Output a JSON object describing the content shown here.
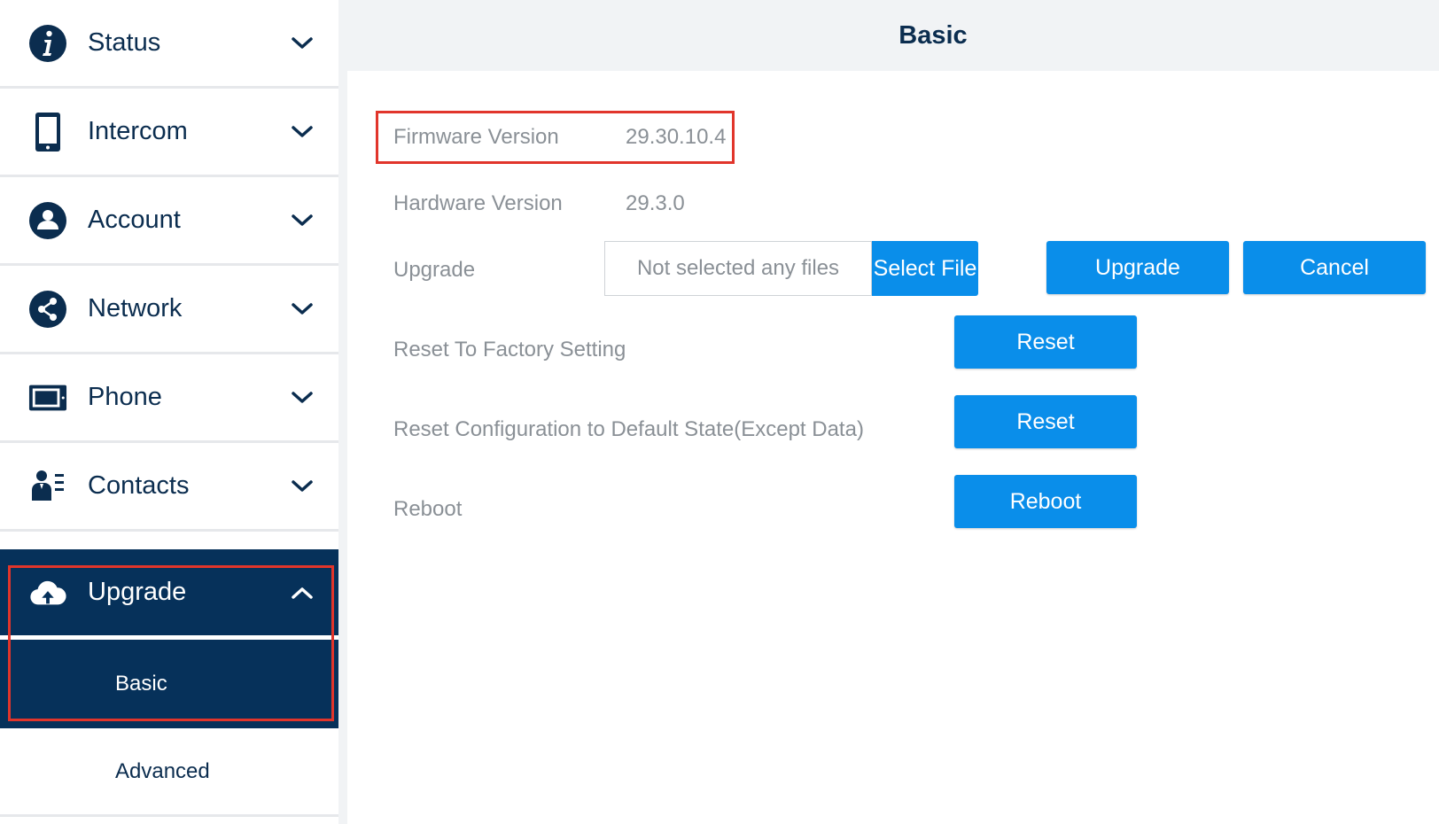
{
  "sidebar": {
    "items": [
      {
        "label": "Status",
        "icon": "info-icon"
      },
      {
        "label": "Intercom",
        "icon": "tablet-icon"
      },
      {
        "label": "Account",
        "icon": "user-icon"
      },
      {
        "label": "Network",
        "icon": "network-icon"
      },
      {
        "label": "Phone",
        "icon": "phone-screen-icon"
      },
      {
        "label": "Contacts",
        "icon": "contacts-icon"
      },
      {
        "label": "Upgrade",
        "icon": "cloud-upload-icon"
      }
    ],
    "subitems": [
      {
        "label": "Basic"
      },
      {
        "label": "Advanced"
      }
    ]
  },
  "main": {
    "title": "Basic",
    "firmware": {
      "label": "Firmware Version",
      "value": "29.30.10.4"
    },
    "hardware": {
      "label": "Hardware Version",
      "value": "29.3.0"
    },
    "upgrade": {
      "label": "Upgrade",
      "file_status": "Not selected any files",
      "select_file_label": "Select File",
      "upgrade_label": "Upgrade",
      "cancel_label": "Cancel"
    },
    "reset_factory": {
      "label": "Reset To Factory Setting",
      "button": "Reset"
    },
    "reset_config": {
      "label": "Reset Configuration to Default State(Except Data)",
      "button": "Reset"
    },
    "reboot": {
      "label": "Reboot",
      "button": "Reboot"
    }
  },
  "colors": {
    "navy": "#06315a",
    "text_navy": "#0b2d4f",
    "button_blue": "#0a8eea",
    "highlight_red": "#e1352b",
    "label_gray": "#8a9096"
  }
}
